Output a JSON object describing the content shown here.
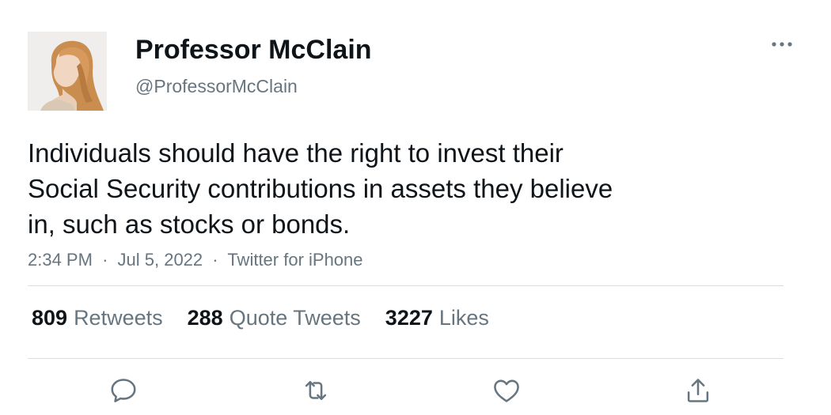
{
  "user": {
    "display_name": "Professor McClain",
    "handle": "@ProfessorMcClain"
  },
  "tweet": {
    "lines": [
      "Individuals should have the right to invest their",
      "Social Security contributions in assets they believe",
      "in, such as stocks or bonds."
    ],
    "time": "2:34 PM",
    "date": "Jul 5, 2022",
    "source": "Twitter for iPhone",
    "separator": "·"
  },
  "stats": {
    "retweets": {
      "count": "809",
      "label": "Retweets"
    },
    "quote_tweets": {
      "count": "288",
      "label": "Quote Tweets"
    },
    "likes": {
      "count": "3227",
      "label": "Likes"
    }
  },
  "icons": {
    "more": "more-horizontal-icon",
    "reply": "reply-icon",
    "retweet": "retweet-icon",
    "like": "heart-icon",
    "share": "share-icon"
  },
  "colors": {
    "text_primary": "#0f1419",
    "text_secondary": "#66757f",
    "divider": "#d9dde0"
  }
}
